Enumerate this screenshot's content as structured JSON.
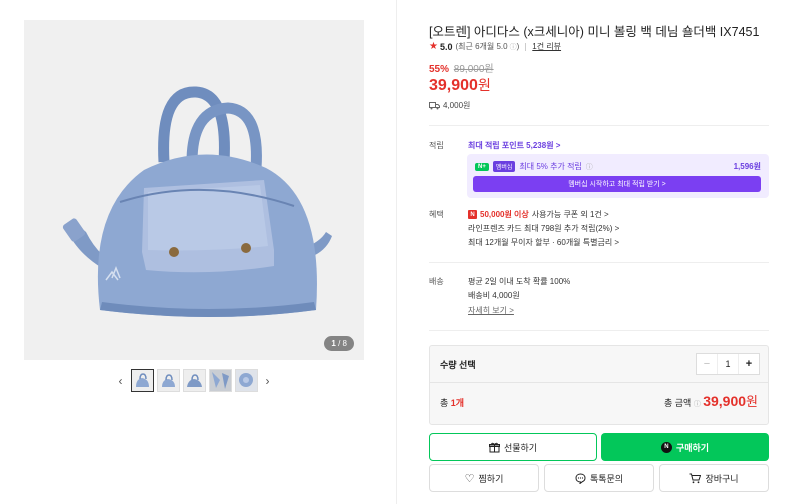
{
  "gallery": {
    "page_current": "1",
    "page_total": "/ 8",
    "prev_icon": "chevron-left",
    "next_icon": "chevron-right",
    "thumbnail_count": 5
  },
  "product": {
    "title": "[오트렌] 아디다스 (x크세니아) 미니 볼링 백 데님 숄더백 IX7451",
    "rating_score": "5.0",
    "rating_recent": "(최근 6개월 5.0",
    "review_count": "1건 리뷰",
    "discount": "55%",
    "original_price": "89,000원",
    "price_value": "39,900",
    "price_unit": "원",
    "shipping_fee": "4,000원"
  },
  "points": {
    "label": "적립",
    "max_points": "최대 적립 포인트 5,238원 >",
    "np_badge": "N+",
    "membership_badge": "멤버십",
    "extra_rate": "최대 5% 추가 적립",
    "extra_amount": "1,596원",
    "cta": "멤버십 시작하고 최대 적립 받기 >"
  },
  "benefits": {
    "label": "혜택",
    "coupon_badge": "N",
    "coupon_amount": "50,000원 이상",
    "coupon_text": "사용가능 쿠폰 외 1건 >",
    "card_text": "라인프렌즈 카드 최대 798원 추가 적립(2%) >",
    "installment_text": "최대 12개월 무이자 할부 · 60개월 특별금리 >"
  },
  "delivery": {
    "label": "배송",
    "arrival": "평균 2일 이내 도착 확률 100%",
    "fee": "배송비 4,000원",
    "detail_link": "자세히 보기 >"
  },
  "quantity": {
    "label": "수량 선택",
    "value": "1",
    "minus": "−",
    "plus": "+",
    "total_prefix": "총",
    "total_count": "1개",
    "total_label": "총 금액",
    "total_price": "39,900",
    "total_unit": "원"
  },
  "actions": {
    "gift": "선물하기",
    "buy": "구매하기",
    "buy_logo": "N",
    "wish": "찜하기",
    "talk": "톡톡문의",
    "cart": "장바구니"
  },
  "colors": {
    "accent_red": "#e4312b",
    "naver_green": "#03c75a",
    "membership_purple": "#7b3ff2"
  }
}
